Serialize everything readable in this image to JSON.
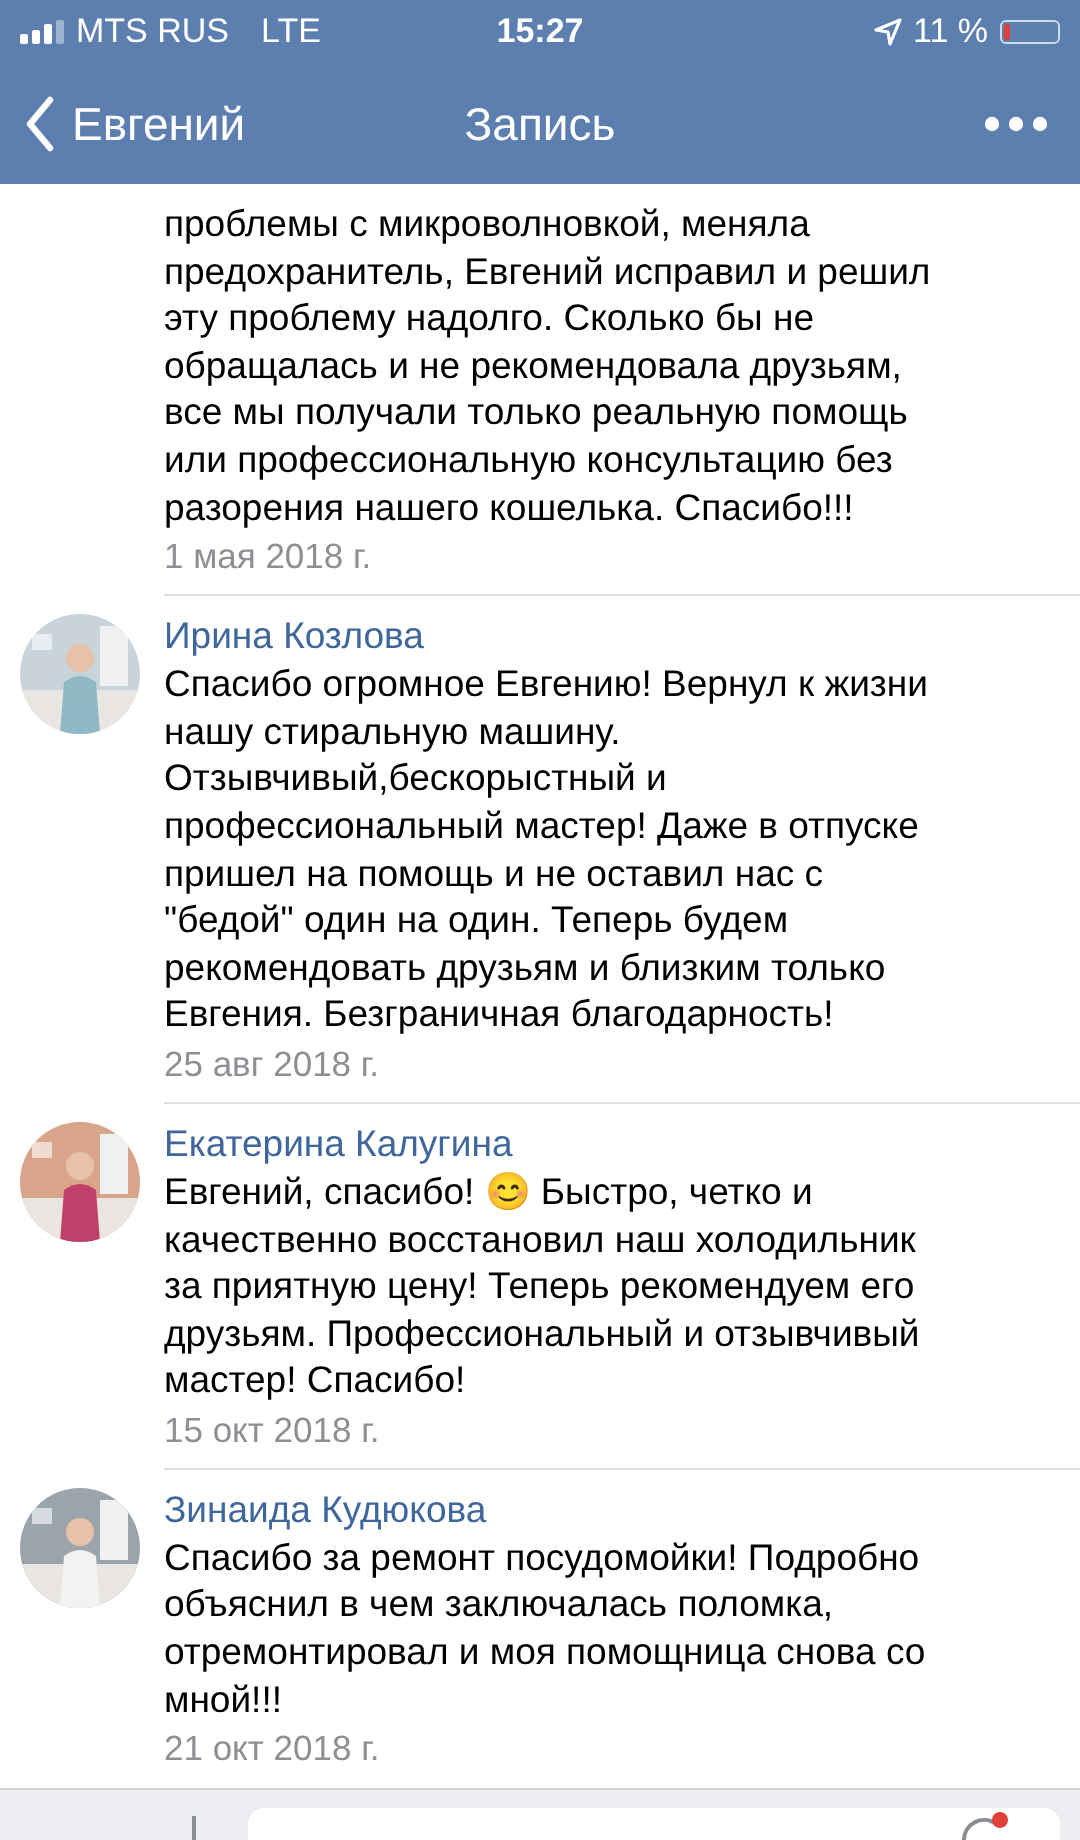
{
  "status_bar": {
    "carrier": "MTS RUS",
    "network": "LTE",
    "time": "15:27",
    "battery": "11 %"
  },
  "nav": {
    "back": "Евгений",
    "title": "Запись"
  },
  "comments": [
    {
      "text": "проблемы с микроволновкой, меняла\nпредохранитель, Евгений исправил и решил\nэту проблему надолго. Сколько бы не\nобращалась и не рекомендовала друзьям,\nвсе мы получали только реальную помощь\nили профессиональную консультацию без\nразорения нашего кошелька. Спасибо!!!",
      "date": "1 мая 2018 г."
    },
    {
      "name": "Ирина Козлова",
      "text": "Спасибо огромное Евгению! Вернул к жизни\nнашу стиральную машину.\nОтзывчивый,бескорыстный и\nпрофессиональный мастер! Даже в отпуске\nпришел на помощь и не оставил нас с\n\"бедой\" один на один. Теперь будем\nрекомендовать друзьям и близким только\nЕвгения. Безграничная благодарность!",
      "date": "25 авг 2018 г."
    },
    {
      "name": "Екатерина Калугина",
      "text": "Евгений, спасибо! 😊 Быстро, четко и\nкачественно восстановил наш холодильник\nза приятную цену! Теперь рекомендуем его\nдрузьям. Профессиональный и отзывчивый\nмастер! Спасибо!",
      "date": "15 окт 2018 г."
    },
    {
      "name": "Зинаида Кудюкова",
      "text": "Спасибо за ремонт посудомойки! Подробно\nобъяснил в чем заключалась поломка,\nотремонтировал и моя помощница снова со\nмной!!!",
      "date": "21 окт 2018 г."
    }
  ]
}
